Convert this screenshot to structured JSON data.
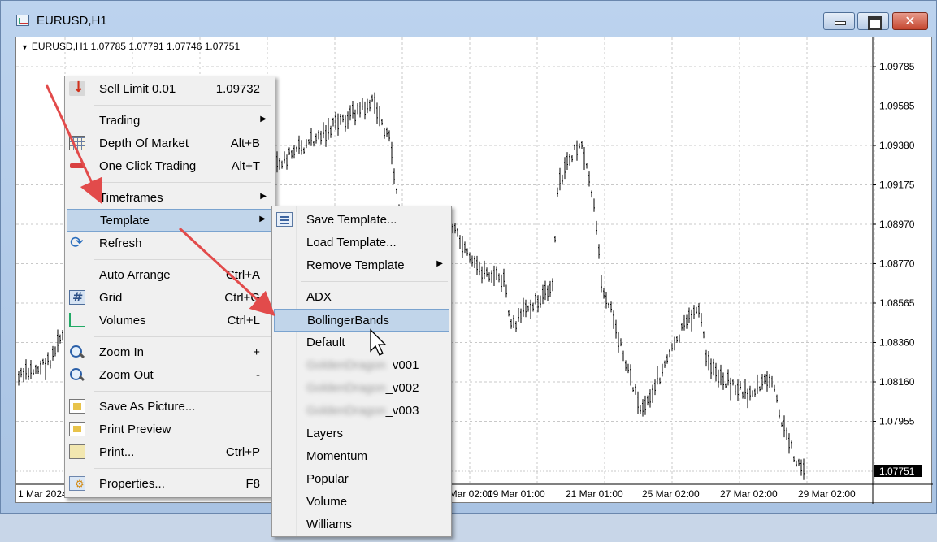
{
  "window": {
    "title": "EURUSD,H1",
    "close_glyph": "✕"
  },
  "chart": {
    "header": "EURUSD,H1  1.07785 1.07791 1.07746 1.07751",
    "price_labels": [
      "1.09785",
      "1.09585",
      "1.09380",
      "1.09175",
      "1.08970",
      "1.08770",
      "1.08565",
      "1.08360",
      "1.08160",
      "1.07955"
    ],
    "current_price": "1.07751",
    "time_labels": [
      "1 Mar 2024",
      "13 Mar 02:00",
      "19 Mar 01:00",
      "21 Mar 01:00",
      "25 Mar 02:00",
      "27 Mar 02:00",
      "29 Mar 02:00"
    ]
  },
  "context_menu": {
    "items": [
      {
        "label": "Sell Limit 0.01",
        "value": "1.09732",
        "icon": "sell-arrow-icon"
      },
      {
        "label": "Trading",
        "submenu": true
      },
      {
        "label": "Depth Of Market",
        "value": "Alt+B",
        "icon": "depth-of-market-icon"
      },
      {
        "label": "One Click Trading",
        "value": "Alt+T",
        "icon": "one-click-trading-icon"
      },
      {
        "label": "Timeframes",
        "submenu": true
      },
      {
        "label": "Template",
        "submenu": true,
        "highlighted": true
      },
      {
        "label": "Refresh",
        "icon": "refresh-icon"
      },
      {
        "label": "Auto Arrange",
        "value": "Ctrl+A"
      },
      {
        "label": "Grid",
        "value": "Ctrl+G",
        "icon": "grid-icon"
      },
      {
        "label": "Volumes",
        "value": "Ctrl+L",
        "icon": "volumes-icon"
      },
      {
        "label": "Zoom In",
        "value": "+",
        "icon": "zoom-in-icon"
      },
      {
        "label": "Zoom Out",
        "value": "-",
        "icon": "zoom-out-icon"
      },
      {
        "label": "Save As Picture...",
        "icon": "save-picture-icon"
      },
      {
        "label": "Print Preview",
        "icon": "print-preview-icon"
      },
      {
        "label": "Print...",
        "value": "Ctrl+P",
        "icon": "print-icon"
      },
      {
        "label": "Properties...",
        "value": "F8",
        "icon": "properties-icon"
      }
    ]
  },
  "template_submenu": {
    "items": [
      {
        "label": "Save Template...",
        "icon": "save-template-icon"
      },
      {
        "label": "Load Template..."
      },
      {
        "label": "Remove Template",
        "submenu": true
      },
      {
        "label": "ADX"
      },
      {
        "label": "BollingerBands",
        "highlighted": true
      },
      {
        "label": "Default"
      },
      {
        "label": "GoldenDragon_v001",
        "blurred_part": "GoldenDragon",
        "visible_part": "_v001"
      },
      {
        "label": "GoldenDragon_v002",
        "blurred_part": "GoldenDragon",
        "visible_part": "_v002"
      },
      {
        "label": "GoldenDragon_v003",
        "blurred_part": "GoldenDragon",
        "visible_part": "_v003"
      },
      {
        "label": "Layers"
      },
      {
        "label": "Momentum"
      },
      {
        "label": "Popular"
      },
      {
        "label": "Volume"
      },
      {
        "label": "Williams"
      }
    ]
  },
  "colors": {
    "highlight": "#c1d5ea",
    "annotation_arrow": "#e24b4b",
    "candle": "#000000"
  }
}
